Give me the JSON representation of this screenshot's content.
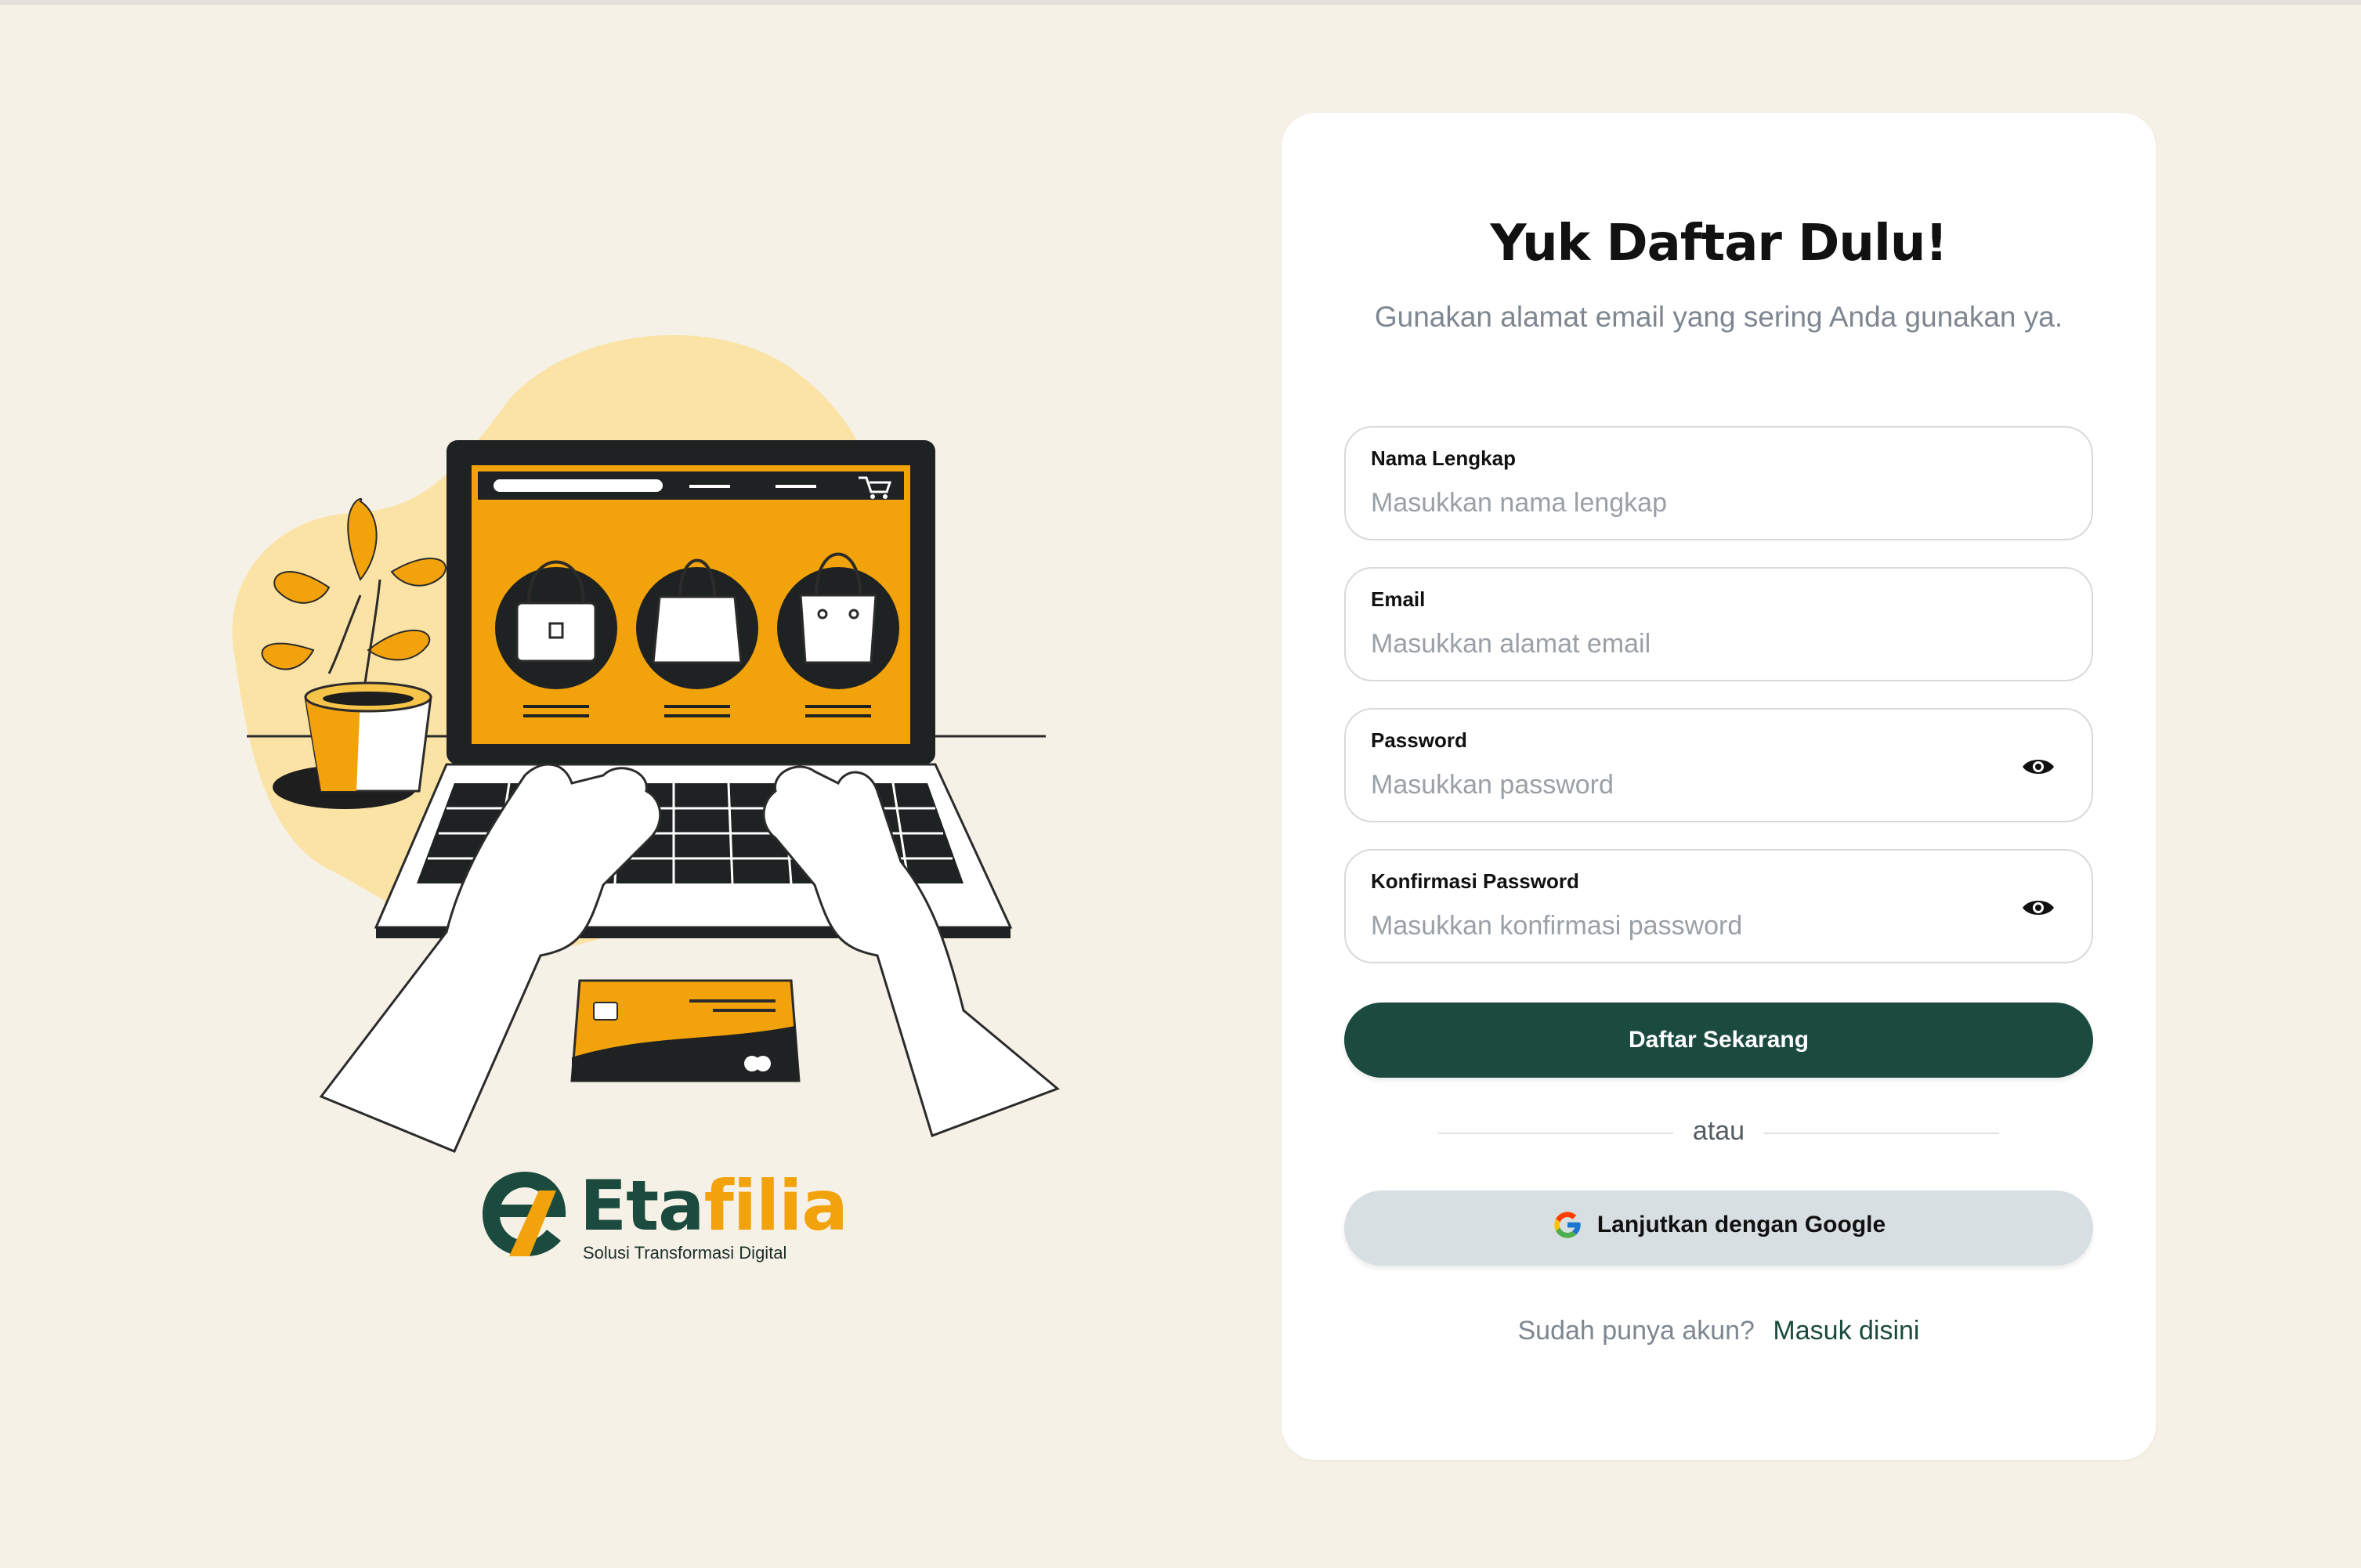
{
  "brand": {
    "name_part1": "Eta",
    "name_part2": "filia",
    "tagline": "Solusi Transformasi Digital"
  },
  "form": {
    "title": "Yuk Daftar Dulu!",
    "subtitle": "Gunakan alamat email yang sering Anda gunakan ya.",
    "fields": [
      {
        "label": "Nama Lengkap",
        "placeholder": "Masukkan nama lengkap",
        "value": ""
      },
      {
        "label": "Email",
        "placeholder": "Masukkan alamat email",
        "value": ""
      },
      {
        "label": "Password",
        "placeholder": "Masukkan password",
        "value": "",
        "icon": "eye-icon"
      },
      {
        "label": "Konfirmasi Password",
        "placeholder": "Masukkan konfirmasi password",
        "value": "",
        "icon": "eye-icon"
      }
    ],
    "submit_label": "Daftar Sekarang",
    "divider_text": "atau",
    "google_label": "Lanjutkan dengan Google",
    "signin_prompt": "Sudah punya akun?",
    "signin_link": "Masuk disini"
  },
  "colors": {
    "background": "#f6f1e6",
    "primary": "#1b4b3e",
    "accent": "#f2a20a",
    "google_button": "#d8dfe2"
  }
}
